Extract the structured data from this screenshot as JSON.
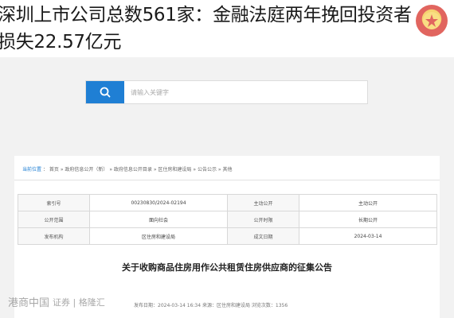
{
  "headline": {
    "line1": "深圳上市公司总数561家：金融法庭两年挽回投资者",
    "line2": "损失22.57亿元"
  },
  "search": {
    "placeholder": "请输入关键字"
  },
  "breadcrumb": {
    "items": [
      "当前位置",
      "首页",
      "政府信息公开（新）",
      "政府信息公开目录",
      "区住房和建设局",
      "公告公示",
      "其他"
    ]
  },
  "info_table": {
    "rows": [
      [
        "索引号",
        "00230830/2024-02194",
        "主动公开",
        "主动公开"
      ],
      [
        "公开范围",
        "面向社会",
        "公开时限",
        "长期公开"
      ],
      [
        "发布机构",
        "区住房和建设局",
        "成文日期",
        "2024-03-14"
      ]
    ]
  },
  "notice": {
    "title": "关于收购商品住房用作公共租赁住房供应商的征集公告"
  },
  "meta": {
    "text": "发布日期：2024-03-14  16:34    来源：区住房和建设局    浏览次数：1356"
  },
  "watermark": {
    "left": "港商中国",
    "right": "证券 | 格隆汇"
  },
  "colors": {
    "accent": "#1f7fd4",
    "backdrop": "#f2f2f2"
  }
}
